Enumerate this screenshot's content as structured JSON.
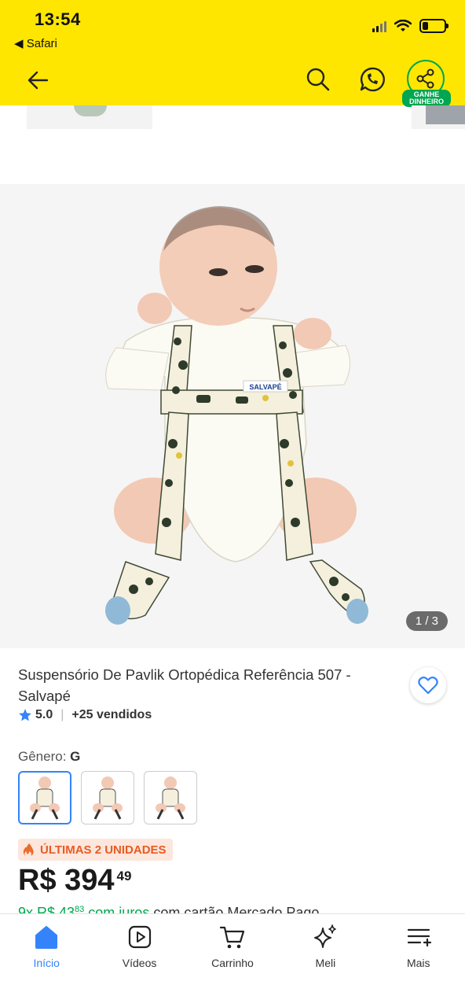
{
  "status_bar": {
    "time": "13:54",
    "back_app": "◀ Safari",
    "battery_level": 0.25
  },
  "header": {
    "share_badge": "GANHE DINHEIRO",
    "colors": {
      "background": "#ffe600",
      "share": "#00a650"
    }
  },
  "gallery": {
    "counter": "1 / 3",
    "label_on_product": "SALVAPÉ"
  },
  "product": {
    "title": "Suspensório De Pavlik Ortopédica Referência 507 - Salvapé",
    "rating": "5.0",
    "sold": "+25 vendidos",
    "genre_label": "Gênero:",
    "genre_value": "G",
    "urgency": "ÚLTIMAS 2 UNIDADES",
    "price_main": "R$ 394",
    "price_cents": "49",
    "install_prefix": "9x R$ 43",
    "install_cents": "83",
    "install_suffix": " com juros",
    "install_rest": " com cartão Mercado Pago"
  },
  "bottom_nav": [
    {
      "label": "Início",
      "icon": "home-icon",
      "active": true
    },
    {
      "label": "Vídeos",
      "icon": "video-icon",
      "active": false
    },
    {
      "label": "Carrinho",
      "icon": "cart-icon",
      "active": false
    },
    {
      "label": "Meli",
      "icon": "sparkle-icon",
      "active": false
    },
    {
      "label": "Mais",
      "icon": "menu-icon",
      "active": false
    }
  ]
}
